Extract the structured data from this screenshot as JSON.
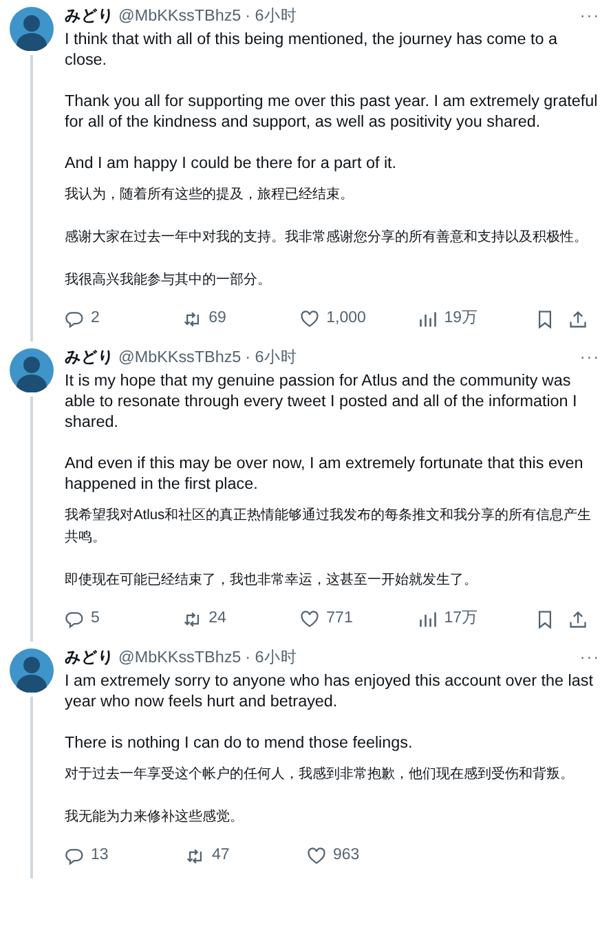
{
  "tweets": [
    {
      "name": "みどり",
      "handle": "@MbKKssTBhz5",
      "time": "· 6小时",
      "more": "···",
      "blocks": [
        {
          "kind": "original",
          "paragraphs": [
            "I think that with all of this being mentioned, the journey has come to a close.",
            "Thank you all for supporting me over this past year. I am extremely grateful for all of the kindness and support, as well as positivity you shared.",
            "And I am happy I could be there for a part of it."
          ]
        },
        {
          "kind": "translation",
          "paragraphs": [
            "我认为，随着所有这些的提及，旅程已经结束。",
            "感谢大家在过去一年中对我的支持。我非常感谢您分享的所有善意和支持以及积极性。",
            "我很高兴我能参与其中的一部分。"
          ]
        }
      ],
      "actions": [
        {
          "kind": "reply",
          "count": "2"
        },
        {
          "kind": "retweet",
          "count": "69"
        },
        {
          "kind": "like",
          "count": "1,000"
        },
        {
          "kind": "views",
          "count": "19万"
        },
        {
          "kind": "bookmark"
        },
        {
          "kind": "share"
        }
      ]
    },
    {
      "name": "みどり",
      "handle": "@MbKKssTBhz5",
      "time": "· 6小时",
      "more": "···",
      "blocks": [
        {
          "kind": "original",
          "paragraphs": [
            "It is my hope that my genuine passion for Atlus and the community was able to resonate through every tweet I posted and all of the information I shared.",
            "And even if this may be over now, I am extremely fortunate that this even happened in the first place."
          ]
        },
        {
          "kind": "translation",
          "paragraphs": [
            "我希望我对Atlus和社区的真正热情能够通过我发布的每条推文和我分享的所有信息产生共鸣。",
            "即使现在可能已经结束了，我也非常幸运，这甚至一开始就发生了。"
          ]
        }
      ],
      "actions": [
        {
          "kind": "reply",
          "count": "5"
        },
        {
          "kind": "retweet",
          "count": "24"
        },
        {
          "kind": "like",
          "count": "771"
        },
        {
          "kind": "views",
          "count": "17万"
        },
        {
          "kind": "bookmark"
        },
        {
          "kind": "share"
        }
      ]
    },
    {
      "name": "みどり",
      "handle": "@MbKKssTBhz5",
      "time": "· 6小时",
      "more": "···",
      "blocks": [
        {
          "kind": "original",
          "paragraphs": [
            "I am extremely sorry to anyone who has enjoyed this account over the last year who now feels hurt and betrayed.",
            "There is nothing I can do to mend those feelings."
          ]
        },
        {
          "kind": "translation",
          "paragraphs": [
            "对于过去一年享受这个帐户的任何人，我感到非常抱歉，他们现在感到受伤和背叛。",
            "我无能为力来修补这些感觉。"
          ]
        }
      ],
      "actions": [
        {
          "kind": "reply",
          "count": "13"
        },
        {
          "kind": "retweet",
          "count": "47"
        },
        {
          "kind": "like",
          "count": "963"
        }
      ]
    }
  ]
}
